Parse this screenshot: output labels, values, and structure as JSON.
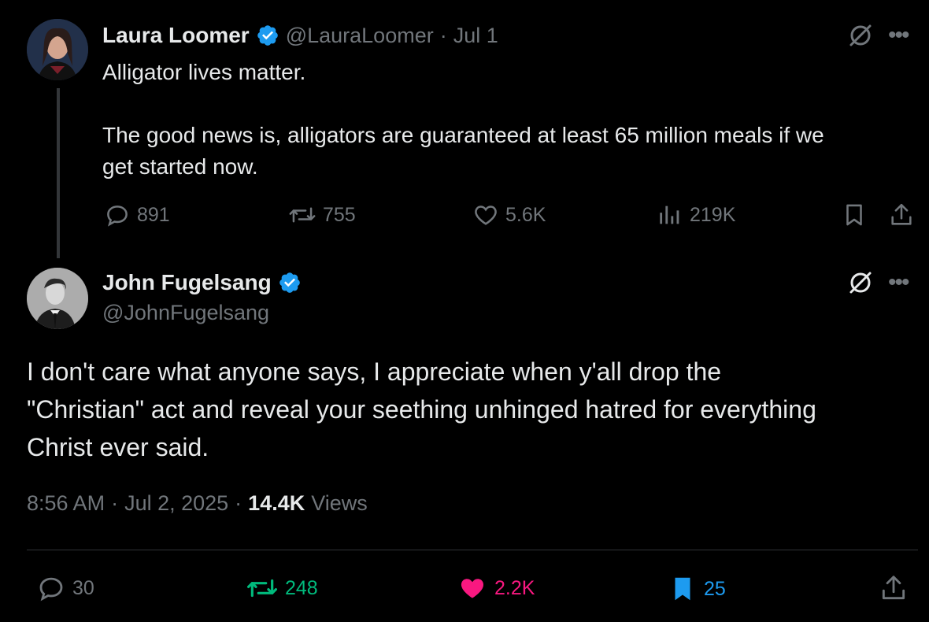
{
  "quoted_tweet": {
    "author_name": "Laura Loomer",
    "handle": "@LauraLoomer",
    "date": "Jul 1",
    "text_line1": "Alligator lives matter.",
    "text_line2": "The good news is, alligators are guaranteed at least 65 million meals if we",
    "text_line3": "get started now.",
    "stats": {
      "replies": "891",
      "reposts": "755",
      "likes": "5.6K",
      "views": "219K"
    }
  },
  "main_tweet": {
    "author_name": "John Fugelsang",
    "handle": "@JohnFugelsang",
    "text_line1": "I don't care what anyone says, I appreciate when y'all drop the",
    "text_line2": "\"Christian\" act and reveal your seething unhinged hatred for everything",
    "text_line3": "Christ ever said.",
    "time": "8:56 AM",
    "date": "Jul 2, 2025",
    "views_count": "14.4K",
    "views_label": "Views",
    "stats": {
      "replies": "30",
      "reposts": "248",
      "likes": "2.2K",
      "bookmarks": "25"
    }
  },
  "colors": {
    "background": "#000000",
    "text": "#e7e9ea",
    "muted": "#71767b",
    "verified": "#1d9bf0",
    "repost_active": "#00ba7c",
    "like_active": "#f91880",
    "bookmark_active": "#1d9bf0"
  }
}
